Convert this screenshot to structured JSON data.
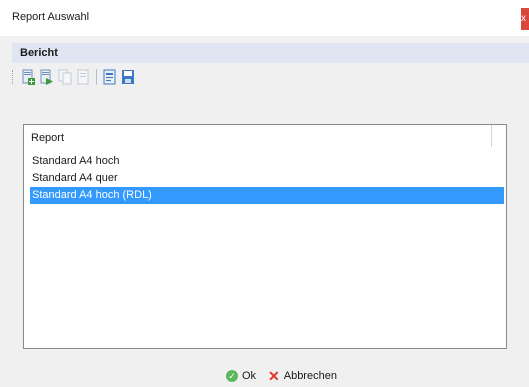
{
  "window": {
    "title": "Report Auswahl",
    "close_glyph": "x"
  },
  "menu": {
    "items": [
      {
        "label": "Bericht"
      }
    ]
  },
  "toolbar": {
    "buttons": [
      {
        "icon": "report-new-icon",
        "color": "#3a9a3a"
      },
      {
        "icon": "report-add-icon",
        "color": "#3a9a3a"
      },
      {
        "icon": "report-copy-icon",
        "color": "#b9c2cf"
      },
      {
        "icon": "report-delete-icon",
        "color": "#b9c2cf"
      },
      {
        "icon": "report-edit-icon",
        "color": "#3d78c7"
      },
      {
        "icon": "report-save-icon",
        "color": "#3d78c7"
      }
    ]
  },
  "report_list": {
    "header": "Report",
    "rows": [
      {
        "label": "Standard A4 hoch",
        "selected": false
      },
      {
        "label": "Standard A4 quer",
        "selected": false
      },
      {
        "label": "Standard A4 hoch (RDL)",
        "selected": true
      }
    ],
    "selection_color": "#3399ff"
  },
  "footer": {
    "ok_label": "Ok",
    "cancel_label": "Abbrechen",
    "ok_icon": "check-circle-icon",
    "cancel_icon": "x-cancel-icon"
  }
}
